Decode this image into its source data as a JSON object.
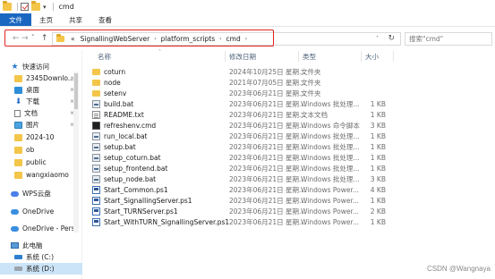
{
  "window": {
    "title": "cmd",
    "qa_dropdown": "▾"
  },
  "ribbon": {
    "tabs": [
      "文件",
      "主页",
      "共享",
      "查看"
    ]
  },
  "nav": {
    "back": "←",
    "forward": "→",
    "recent": "˅",
    "up": "↑"
  },
  "address": {
    "overflow": "«",
    "segments": [
      "SignallingWebServer",
      "platform_scripts",
      "cmd"
    ],
    "separator": "›",
    "dropdown": "˅",
    "refresh": "↻",
    "highlight_color": "#e0241d"
  },
  "search": {
    "placeholder": "搜索\"cmd\""
  },
  "sidebar": {
    "items": [
      {
        "label": "快速访问",
        "icon": "star-icon",
        "pinned": false,
        "selected": false
      },
      {
        "label": "2345Downlo...",
        "icon": "folder-icon",
        "pinned": true,
        "selected": false
      },
      {
        "label": "桌面",
        "icon": "desktop-icon",
        "pinned": true,
        "selected": false
      },
      {
        "label": "下载",
        "icon": "download-icon",
        "pinned": true,
        "selected": false
      },
      {
        "label": "文档",
        "icon": "document-icon",
        "pinned": true,
        "selected": false
      },
      {
        "label": "图片",
        "icon": "pictures-icon",
        "pinned": true,
        "selected": false
      },
      {
        "label": "2024-10",
        "icon": "folder-icon",
        "pinned": false,
        "selected": false
      },
      {
        "label": "ob",
        "icon": "folder-icon",
        "pinned": false,
        "selected": false
      },
      {
        "label": "public",
        "icon": "folder-icon",
        "pinned": false,
        "selected": false
      },
      {
        "label": "wangxiaomo",
        "icon": "folder-icon",
        "pinned": false,
        "selected": false
      },
      {
        "label": "WPS云盘",
        "icon": "cloud-icon",
        "pinned": false,
        "selected": false
      },
      {
        "label": "OneDrive",
        "icon": "onedrive-icon",
        "pinned": false,
        "selected": false
      },
      {
        "label": "OneDrive - Perso",
        "icon": "onedrive-icon",
        "pinned": false,
        "selected": false
      },
      {
        "label": "此电脑",
        "icon": "pc-icon",
        "pinned": false,
        "selected": false
      },
      {
        "label": "系统 (C:)",
        "icon": "drive-icon",
        "pinned": false,
        "selected": false
      },
      {
        "label": "系统 (D:)",
        "icon": "drive-icon",
        "pinned": false,
        "selected": true
      }
    ],
    "pin_glyph": "⨯"
  },
  "filelist": {
    "headers": {
      "name": "名称",
      "date": "修改日期",
      "type": "类型",
      "size": "大小"
    },
    "sort_indicator": "˄",
    "rows": [
      {
        "name": "coturn",
        "date": "2024年10月25日 星期...",
        "type": "文件夹",
        "size": "",
        "icon": "folder-icon"
      },
      {
        "name": "node",
        "date": "2021年07月05日 星期...",
        "type": "文件夹",
        "size": "",
        "icon": "folder-icon"
      },
      {
        "name": "setenv",
        "date": "2023年06月21日 星期...",
        "type": "文件夹",
        "size": "",
        "icon": "folder-icon"
      },
      {
        "name": "build.bat",
        "date": "2023年06月21日 星期...",
        "type": "Windows 批处理...",
        "size": "1 KB",
        "icon": "batch-file-icon"
      },
      {
        "name": "README.txt",
        "date": "2023年06月21日 星期...",
        "type": "文本文档",
        "size": "1 KB",
        "icon": "text-file-icon"
      },
      {
        "name": "refreshenv.cmd",
        "date": "2023年06月21日 星期...",
        "type": "Windows 命令脚本",
        "size": "3 KB",
        "icon": "cmd-file-icon"
      },
      {
        "name": "run_local.bat",
        "date": "2023年06月21日 星期...",
        "type": "Windows 批处理...",
        "size": "1 KB",
        "icon": "batch-file-icon"
      },
      {
        "name": "setup.bat",
        "date": "2023年06月21日 星期...",
        "type": "Windows 批处理...",
        "size": "1 KB",
        "icon": "batch-file-icon"
      },
      {
        "name": "setup_coturn.bat",
        "date": "2023年06月21日 星期...",
        "type": "Windows 批处理...",
        "size": "1 KB",
        "icon": "batch-file-icon"
      },
      {
        "name": "setup_frontend.bat",
        "date": "2023年06月21日 星期...",
        "type": "Windows 批处理...",
        "size": "1 KB",
        "icon": "batch-file-icon"
      },
      {
        "name": "setup_node.bat",
        "date": "2023年06月21日 星期...",
        "type": "Windows 批处理...",
        "size": "3 KB",
        "icon": "batch-file-icon"
      },
      {
        "name": "Start_Common.ps1",
        "date": "2023年06月21日 星期...",
        "type": "Windows Power...",
        "size": "4 KB",
        "icon": "powershell-file-icon"
      },
      {
        "name": "Start_SignallingServer.ps1",
        "date": "2023年06月21日 星期...",
        "type": "Windows Power...",
        "size": "1 KB",
        "icon": "powershell-file-icon"
      },
      {
        "name": "Start_TURNServer.ps1",
        "date": "2023年06月21日 星期...",
        "type": "Windows Power...",
        "size": "2 KB",
        "icon": "powershell-file-icon"
      },
      {
        "name": "Start_WithTURN_SignallingServer.ps1",
        "date": "2023年06月21日 星期...",
        "type": "Windows Power...",
        "size": "1 KB",
        "icon": "powershell-file-icon"
      }
    ]
  },
  "watermark": "CSDN @Wangnaya",
  "colors": {
    "accent": "#1a67c1",
    "selection": "#cce4f7",
    "folder": "#f3c64a"
  }
}
